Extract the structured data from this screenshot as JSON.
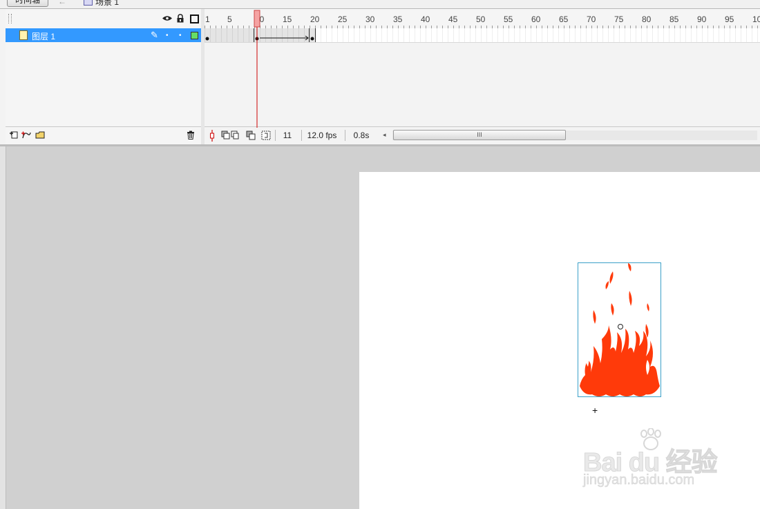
{
  "header": {
    "timeline_tab": "时间轴",
    "back_icon": "back-arrow-icon",
    "scene_label": "场景 1"
  },
  "layers": {
    "header_icons": [
      "eye-icon",
      "lock-icon",
      "outline-icon"
    ],
    "rows": [
      {
        "name": "图层 1",
        "selected": true,
        "outline_color": "#66dd66"
      }
    ],
    "footer_icons": [
      "add-layer-icon",
      "add-motion-guide-icon",
      "add-folder-icon",
      "delete-layer-icon"
    ]
  },
  "timeline": {
    "ruler_labels": [
      "1",
      "5",
      "10",
      "15",
      "20",
      "25",
      "30",
      "35",
      "40",
      "45",
      "50",
      "55",
      "60",
      "65",
      "70",
      "75",
      "80",
      "85",
      "90",
      "95",
      "10"
    ],
    "playhead_frame": 10,
    "keyframes": [
      1,
      10,
      20
    ],
    "tween": {
      "from": 10,
      "to": 20
    },
    "current_frame": "11",
    "frame_rate": "12.0 fps",
    "elapsed_time": "0.8s",
    "scroll_thumb_label": "III"
  },
  "colors": {
    "selection": "#3399ff",
    "playhead": "#cc0000",
    "fire": "#ff3a0a",
    "bbox": "#3aa0c8"
  },
  "watermark": {
    "brand": "Bai du 经验",
    "url": "jingyan.baidu.com"
  }
}
